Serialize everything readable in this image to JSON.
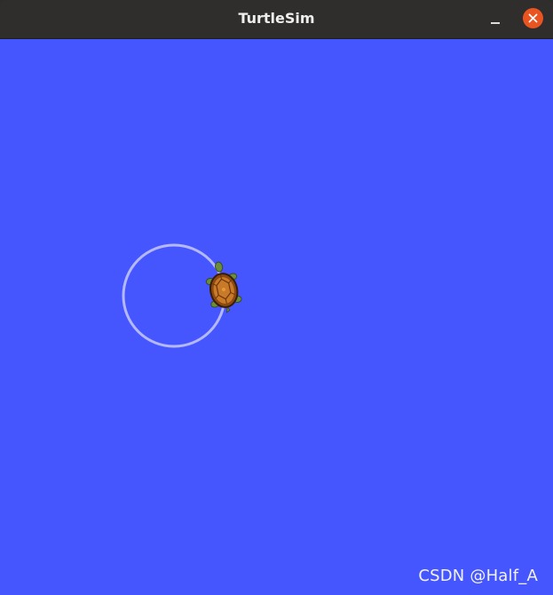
{
  "window": {
    "title": "TurtleSim",
    "controls": {
      "minimize_icon": "minimize-icon",
      "close_icon": "close-icon"
    }
  },
  "canvas": {
    "background_color": "#4556ff",
    "pen_color": "#b4b8ff",
    "turtle_icon": "turtle-icon"
  },
  "watermark": {
    "text": "CSDN @Half_A"
  },
  "colors": {
    "titlebar": "#2f2e2c",
    "close_button": "#e95420",
    "title_text": "#eeeeec"
  }
}
